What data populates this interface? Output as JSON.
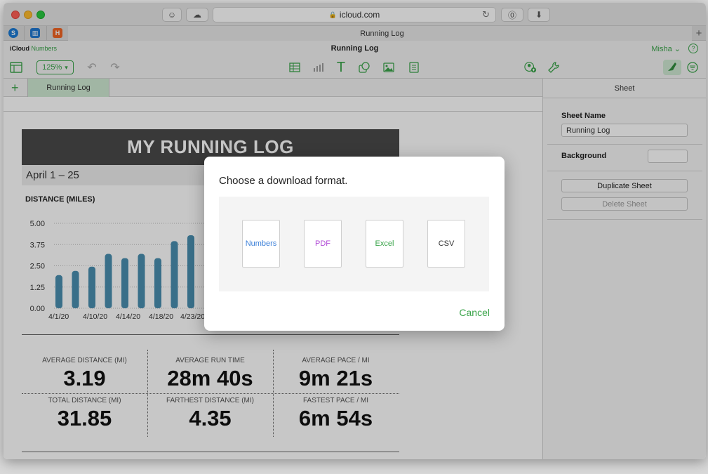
{
  "browser": {
    "url": "icloud.com",
    "tab_title": "Running Log"
  },
  "app": {
    "brand": "iCloud",
    "app_name": "Numbers",
    "doc_title": "Running Log",
    "user": "Misha",
    "zoom": "125%",
    "accent_color": "#3aa44a"
  },
  "sheet_tab": "Running Log",
  "report": {
    "title": "MY RUNNING LOG",
    "date_range": "April 1 – 25",
    "chart_title": "DISTANCE (MILES)"
  },
  "chart_data": {
    "type": "bar",
    "title": "DISTANCE (MILES)",
    "ylim": [
      0,
      5
    ],
    "yticks": [
      "0.00",
      "1.25",
      "2.50",
      "3.75",
      "5.00"
    ],
    "x_tick_labels": [
      "4/1/20",
      "4/10/20",
      "4/14/20",
      "4/18/20",
      "4/23/20"
    ],
    "values": [
      1.95,
      2.2,
      2.45,
      3.2,
      2.95,
      3.2,
      2.95,
      3.95,
      4.3
    ],
    "bar_color": "#4a8fb0",
    "grid": true
  },
  "stats": [
    {
      "label": "AVERAGE DISTANCE (MI)",
      "value": "3.19"
    },
    {
      "label": "AVERAGE RUN TIME",
      "value": "28m 40s"
    },
    {
      "label": "AVERAGE PACE / MI",
      "value": "9m 21s"
    },
    {
      "label": "TOTAL DISTANCE (MI)",
      "value": "31.85"
    },
    {
      "label": "FARTHEST DISTANCE (MI)",
      "value": "4.35"
    },
    {
      "label": "FASTEST PACE / MI",
      "value": "6m 54s"
    }
  ],
  "panel": {
    "header": "Sheet",
    "sheet_name_label": "Sheet Name",
    "sheet_name_value": "Running Log",
    "background_label": "Background",
    "duplicate_label": "Duplicate Sheet",
    "delete_label": "Delete Sheet"
  },
  "modal": {
    "title": "Choose a download format.",
    "formats": [
      {
        "label": "Numbers",
        "color": "#3b7fd8"
      },
      {
        "label": "PDF",
        "color": "#b04ad6"
      },
      {
        "label": "Excel",
        "color": "#3aa44a"
      },
      {
        "label": "CSV",
        "color": "#333333"
      }
    ],
    "cancel_label": "Cancel"
  }
}
